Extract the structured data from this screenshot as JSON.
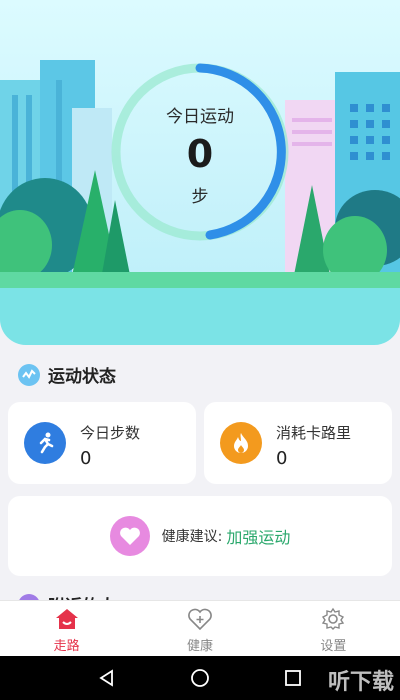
{
  "ring": {
    "title": "今日运动",
    "count": "0",
    "unit": "步"
  },
  "status_section": {
    "title": "运动状态"
  },
  "stats": [
    {
      "label": "今日步数",
      "value": "0",
      "icon": "running-person-icon",
      "color": "#2f7de0"
    },
    {
      "label": "消耗卡路里",
      "value": "0",
      "icon": "flame-icon",
      "color": "#f39a1e"
    }
  ],
  "advice": {
    "label": "健康建议:",
    "value": "加强运动",
    "icon": "heart-icon",
    "value_color": "#2aa86c"
  },
  "nearby_section": {
    "title": "附近的人"
  },
  "tabs": [
    {
      "label": "走路",
      "icon": "home-icon",
      "active": true
    },
    {
      "label": "健康",
      "icon": "heart-plus-icon",
      "active": false
    },
    {
      "label": "设置",
      "icon": "gear-icon",
      "active": false
    }
  ],
  "watermark": "听下载",
  "colors": {
    "accent": "#e5324a",
    "ring": "#2f8fe8",
    "ring_track": "#9be9d0"
  }
}
